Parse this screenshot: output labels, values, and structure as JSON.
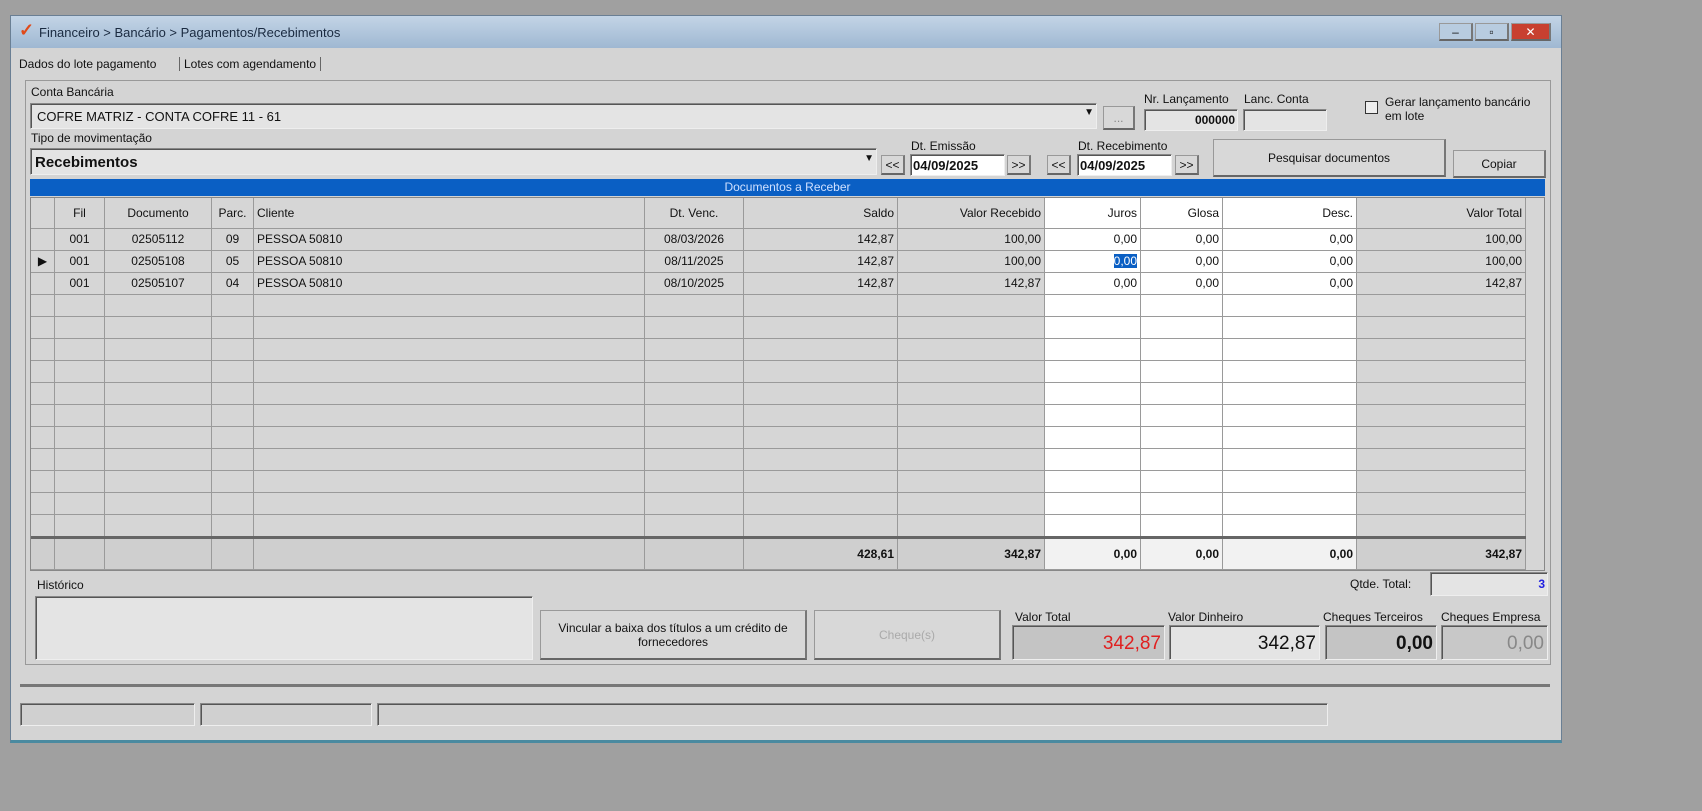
{
  "window": {
    "title": "Financeiro > Bancário > Pagamentos/Recebimentos"
  },
  "tabs": [
    {
      "label": "Dados do lote pagamento"
    },
    {
      "label": "Lotes com agendamento"
    }
  ],
  "form": {
    "conta_label": "Conta Bancária",
    "conta_value": "COFRE MATRIZ - CONTA COFRE 11 - 61",
    "ellipsis": "...",
    "nr_lancamento_label": "Nr. Lançamento",
    "nr_lancamento_value": "000000",
    "lanc_conta_label": "Lanc. Conta",
    "lanc_conta_value": "",
    "gerar_label": "Gerar lançamento bancário em lote",
    "gerar_checked": false,
    "tipo_label": "Tipo de movimentação",
    "tipo_value": "Recebimentos",
    "dt_emissao_label": "Dt. Emissão",
    "dt_emissao_value": "04/09/2025",
    "dt_recebimento_label": "Dt. Recebimento",
    "dt_recebimento_value": "04/09/2025",
    "prev": "<<",
    "next": ">>",
    "pesquisar_label": "Pesquisar documentos",
    "copiar_label": "Copiar"
  },
  "grid": {
    "title": "Documentos a Receber",
    "columns": [
      "",
      "Fil",
      "Documento",
      "Parc.",
      "Cliente",
      "Dt. Venc.",
      "Saldo",
      "Valor Recebido",
      "Juros",
      "Glosa",
      "Desc.",
      "Valor Total"
    ],
    "rows": [
      [
        "",
        "001",
        "02505112",
        "09",
        "PESSOA 50810",
        "08/03/2026",
        "142,87",
        "100,00",
        "0,00",
        "0,00",
        "0,00",
        "100,00"
      ],
      [
        "▶",
        "001",
        "02505108",
        "05",
        "PESSOA 50810",
        "08/11/2025",
        "142,87",
        "100,00",
        "0,00",
        "0,00",
        "0,00",
        "100,00"
      ],
      [
        "",
        "001",
        "02505107",
        "04",
        "PESSOA 50810",
        "08/10/2025",
        "142,87",
        "142,87",
        "0,00",
        "0,00",
        "0,00",
        "142,87"
      ]
    ],
    "totals": [
      "",
      "",
      "",
      "",
      "",
      "",
      "428,61",
      "342,87",
      "0,00",
      "0,00",
      "0,00",
      "342,87"
    ]
  },
  "bottom": {
    "historico_label": "Histórico",
    "historico_value": "",
    "qtde_label": "Qtde. Total:",
    "qtde_value": "3",
    "vincular_label": "Vincular a baixa dos títulos a um crédito de fornecedores",
    "cheques_label": "Cheque(s)",
    "valor_total_label": "Valor Total",
    "valor_total_value": "342,87",
    "valor_dinheiro_label": "Valor Dinheiro",
    "valor_dinheiro_value": "342,87",
    "cheques_terceiros_label": "Cheques Terceiros",
    "cheques_terceiros_value": "0,00",
    "cheques_empresa_label": "Cheques Empresa",
    "cheques_empresa_value": "0,00"
  },
  "colors": {
    "accent": "#0a5fc4",
    "valor_total": "#e02020",
    "qtde": "#2020e0"
  }
}
